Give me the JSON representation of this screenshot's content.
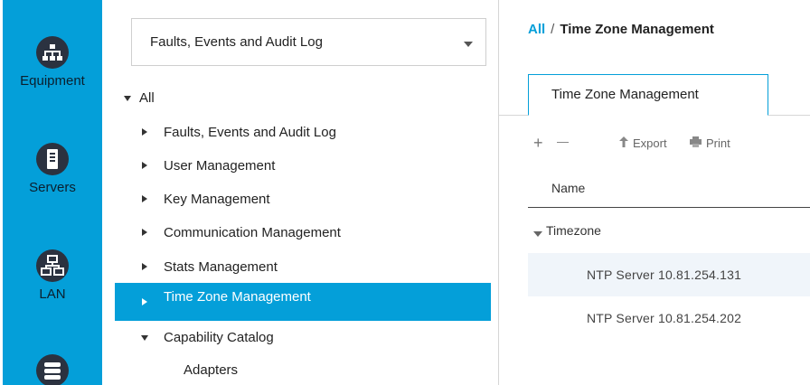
{
  "rail": {
    "items": [
      {
        "label": "Equipment",
        "icon": "equipment-icon"
      },
      {
        "label": "Servers",
        "icon": "server-icon"
      },
      {
        "label": "LAN",
        "icon": "lan-icon"
      },
      {
        "label": "",
        "icon": "storage-icon"
      }
    ],
    "colors": {
      "background": "#049fd9",
      "icon_bg": "#2b3240"
    }
  },
  "nav": {
    "dropdown": {
      "value": "Faults, Events and Audit Log"
    },
    "tree": {
      "root": "All",
      "items": [
        "Faults, Events and Audit Log",
        "User Management",
        "Key Management",
        "Communication Management",
        "Stats Management",
        "Time Zone Management",
        "Capability Catalog",
        "Adapters"
      ],
      "selected": "Time Zone Management"
    }
  },
  "content": {
    "breadcrumb": {
      "root": "All",
      "separator": "/",
      "current": "Time Zone Management"
    },
    "tab": "Time Zone Management",
    "toolbar": {
      "add": "+",
      "remove": "—",
      "export": "Export",
      "print": "Print"
    },
    "grid": {
      "column": "Name",
      "group": "Timezone",
      "rows": [
        "NTP Server 10.81.254.131",
        "NTP Server 10.81.254.202"
      ]
    }
  }
}
